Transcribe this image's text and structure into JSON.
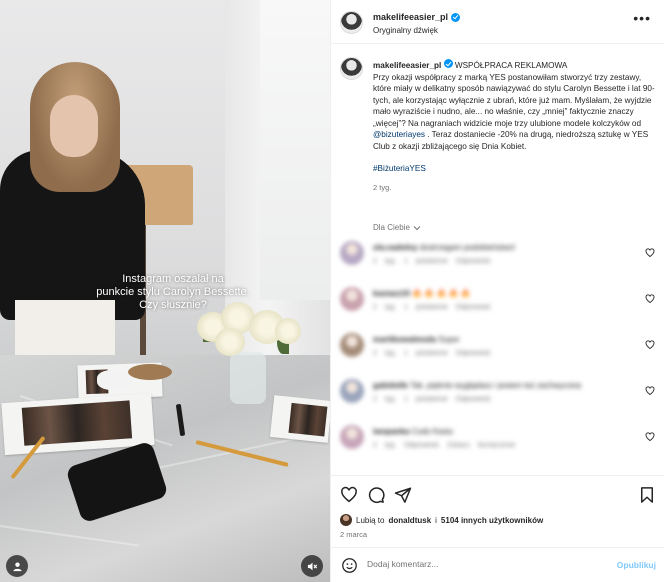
{
  "media": {
    "overlay_lines": [
      "Instagram oszalał na",
      "punkcie stylu Carolyn Bessette.",
      "Czy słusznie?"
    ]
  },
  "header": {
    "username": "makelifeeasier_pl",
    "subtitle": "Oryginalny dźwięk",
    "more_icon": "more-horizontal-icon"
  },
  "caption": {
    "username": "makelifeeasier_pl",
    "partnership": "WSPÓŁPRACA REKLAMOWA",
    "text_1": "Przy okazji współpracy z marką YES postanowiłam stworzyć trzy zestawy, które miały w delikatny sposób nawiązywać do stylu Carolyn Bessette i lat 90-tych, ale korzystając wyłącznie z ubrań, które już mam. Myślałam, że wyjdzie mało wyraziście i nudno, ale... no właśnie, czy „mniej” faktycznie znaczy „więcej”? Na nagraniach widzicie moje trzy ulubione modele kolczyków od",
    "mention": "@bizuteriayes",
    "text_2": ". Teraz dostaniecie -20% na drugą, niedroższą sztukę w YES Club z okazji zbliżającego się Dnia Kobiet.",
    "hashtag": "#BiżuteriaYES",
    "time": "2 tyg."
  },
  "comments_filter": "Dla Ciebie",
  "comments": [
    {
      "user": "ola.nadolny",
      "text": "dostrzegam podobieństwo!",
      "meta": "2 tyg.  1 polubienie  Odpowiedz",
      "avatar_color": "#b7a9c4"
    },
    {
      "user": "kasiazz10",
      "text": "🔥 🔥 🔥 🔥 🔥",
      "meta": "2 tyg.  1 polubienie  Odpowiedz",
      "avatar_color": "#c9a2ae"
    },
    {
      "user": "martikowalmoda",
      "text": "Super",
      "meta": "2 tyg.  1 polubienie  Odpowiedz",
      "avatar_color": "#a68d7a"
    },
    {
      "user": "gabidolle",
      "text": "Tak, pięknie wyglądasz i jestem też zachwycona",
      "meta": "2 tyg.  1 polubienie  Odpowiedz",
      "avatar_color": "#9ba5bc"
    },
    {
      "user": "iwopanka",
      "text": "Cudo Kasiu",
      "meta": "2 tyg.  Odpowiedz  Zobacz tłumaczenie",
      "avatar_color": "#c7a6b9"
    }
  ],
  "actions": {
    "like_icon": "heart-icon",
    "comment_icon": "comment-icon",
    "share_icon": "share-icon",
    "save_icon": "bookmark-icon"
  },
  "likes": {
    "prefix": "Lubią to",
    "user": "donaldtusk",
    "middle": "i",
    "others": "5104 innych użytkowników"
  },
  "date": "2 marca",
  "add_comment": {
    "placeholder": "Dodaj komentarz...",
    "publish": "Opublikuj"
  },
  "colors": {
    "link": "#00376b",
    "verified": "#0095f6",
    "publish_disabled": "#80c9fb",
    "secondary_text": "#737373"
  }
}
